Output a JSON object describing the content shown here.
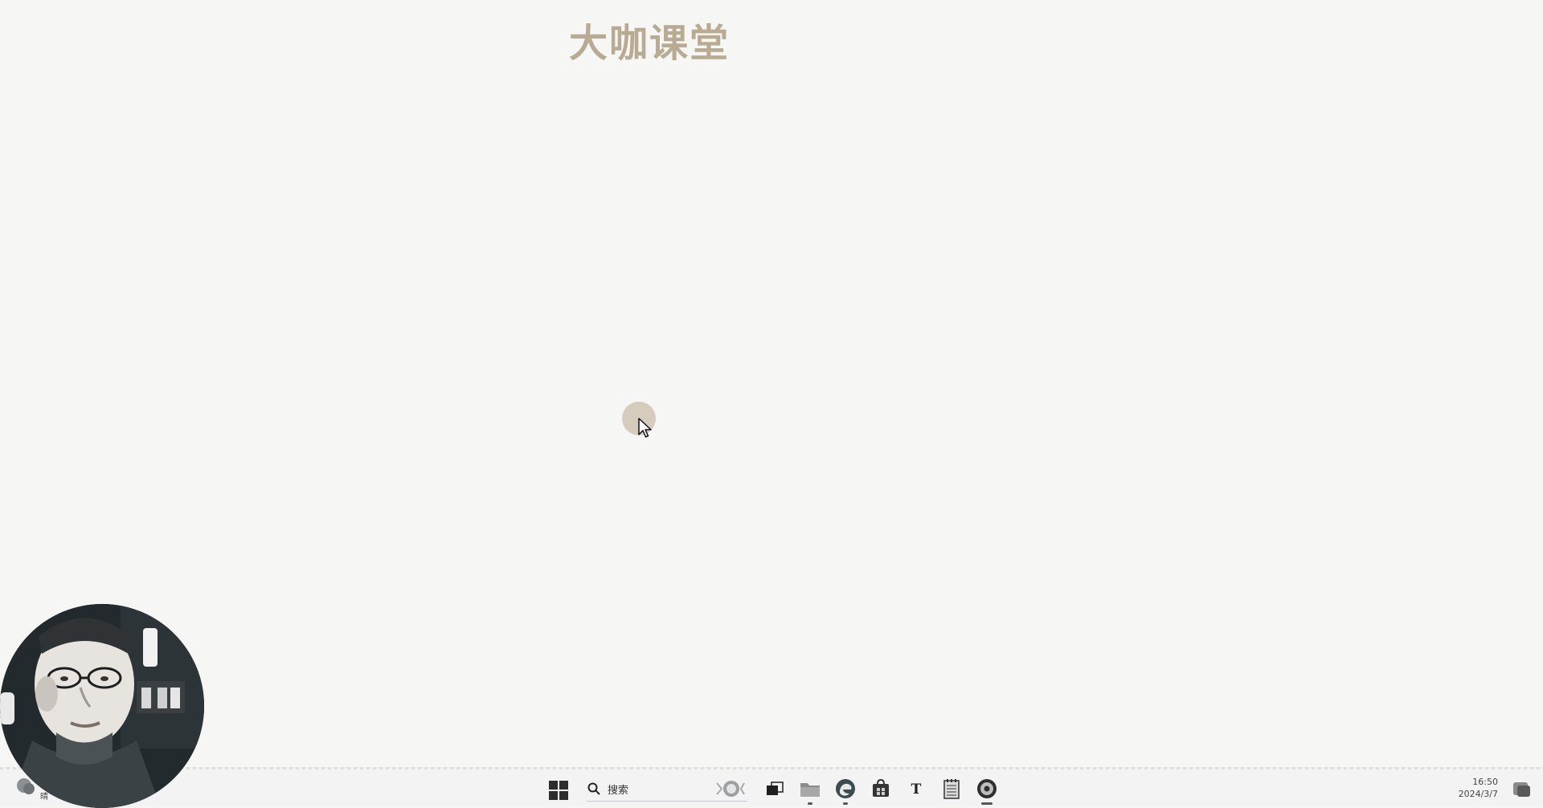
{
  "brand": {
    "title": "大咖课堂"
  },
  "watermark": {
    "text": ""
  },
  "taskbar": {
    "search_placeholder": "搜索",
    "clock_time": "16:50",
    "clock_date": "2024/3/7",
    "left_widget_label": "晴",
    "icons": [
      "start-icon",
      "search-icon",
      "task-view-icon",
      "file-explorer-icon",
      "edge-icon",
      "store-icon",
      "typora-icon",
      "notepad-icon",
      "obs-icon"
    ]
  },
  "colors": {
    "brand": "#b9ab93",
    "desktop_bg": "#f6f6f5",
    "taskbar_bg": "#f3f3f3"
  }
}
